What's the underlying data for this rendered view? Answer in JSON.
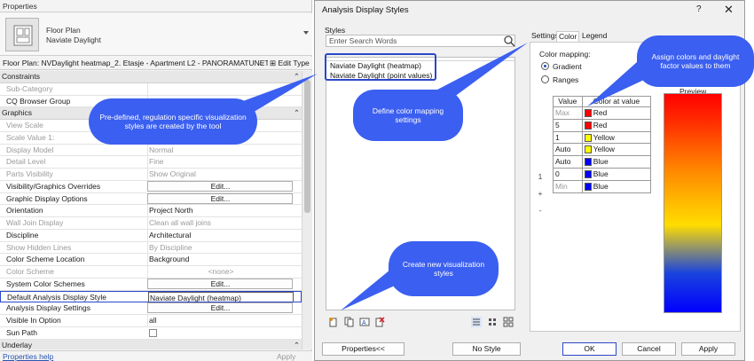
{
  "properties": {
    "title": "Properties",
    "type_line1": "Floor Plan",
    "type_line2": "Naviate Daylight",
    "instance_selector": "Floor Plan: NVDaylight heatmap_2. Etasje - Apartment L2 - PANORAMATUNET",
    "edit_type": "Edit Type",
    "rows": [
      {
        "kind": "cat",
        "label": "Constraints"
      },
      {
        "kind": "text",
        "label": "Sub-Category",
        "value": "",
        "grey": true
      },
      {
        "kind": "text",
        "label": "CQ Browser Group",
        "value": ""
      },
      {
        "kind": "cat",
        "label": "Graphics"
      },
      {
        "kind": "text",
        "label": "View Scale",
        "value": "",
        "grey": true
      },
      {
        "kind": "text",
        "label": "Scale Value    1:",
        "value": "",
        "grey": true
      },
      {
        "kind": "text",
        "label": "Display Model",
        "value": "Normal",
        "grey": true
      },
      {
        "kind": "text",
        "label": "Detail Level",
        "value": "Fine",
        "grey": true
      },
      {
        "kind": "text",
        "label": "Parts Visibility",
        "value": "Show Original",
        "grey": true
      },
      {
        "kind": "btn",
        "label": "Visibility/Graphics Overrides",
        "value": "Edit..."
      },
      {
        "kind": "btn",
        "label": "Graphic Display Options",
        "value": "Edit..."
      },
      {
        "kind": "text",
        "label": "Orientation",
        "value": "Project North"
      },
      {
        "kind": "text",
        "label": "Wall Join Display",
        "value": "Clean all wall joins",
        "grey": true
      },
      {
        "kind": "text",
        "label": "Discipline",
        "value": "Architectural"
      },
      {
        "kind": "text",
        "label": "Show Hidden Lines",
        "value": "By Discipline",
        "grey": true
      },
      {
        "kind": "text",
        "label": "Color Scheme Location",
        "value": "Background"
      },
      {
        "kind": "center",
        "label": "Color Scheme",
        "value": "<none>",
        "grey": true
      },
      {
        "kind": "btn",
        "label": "System Color Schemes",
        "value": "Edit..."
      },
      {
        "kind": "hl",
        "label": "Default Analysis Display Style",
        "value": "Naviate Daylight (heatmap)"
      },
      {
        "kind": "btn",
        "label": "Analysis Display Settings",
        "value": "Edit..."
      },
      {
        "kind": "text",
        "label": "Visible In Option",
        "value": "all"
      },
      {
        "kind": "check",
        "label": "Sun Path",
        "value": ""
      },
      {
        "kind": "cat",
        "label": "Underlay"
      }
    ],
    "help_link": "Properties help",
    "apply": "Apply"
  },
  "dialog": {
    "title": "Analysis Display Styles",
    "help": "?",
    "close": "✕",
    "styles_label": "Styles",
    "search_placeholder": "Enter Search Words",
    "styles": [
      "Naviate Daylight (heatmap)",
      "Naviate Daylight (point values)"
    ],
    "tabs": [
      "Settings",
      "Color",
      "Legend"
    ],
    "active_tab": "Color",
    "color_mapping_label": "Color mapping:",
    "gradient_label": "Gradient",
    "ranges_label": "Ranges",
    "table_headers": [
      "Value",
      "Color at value"
    ],
    "table_rows": [
      {
        "value": "Max",
        "color_name": "Red",
        "color": "#ff0000",
        "grey": true
      },
      {
        "value": "5",
        "color_name": "Red",
        "color": "#ff0000"
      },
      {
        "value": "1",
        "color_name": "Yellow",
        "color": "#ffff00"
      },
      {
        "value": "Auto",
        "color_name": "Yellow",
        "color": "#ffff00"
      },
      {
        "value": "Auto",
        "color_name": "Blue",
        "color": "#0000ff"
      },
      {
        "value": "0",
        "color_name": "Blue",
        "color": "#0000ff"
      },
      {
        "value": "Min",
        "color_name": "Blue",
        "color": "#0000ff",
        "grey": true
      }
    ],
    "row_tools": [
      "1",
      "+",
      "-"
    ],
    "preview_label": "Preview",
    "buttons": {
      "properties": "Properties<<",
      "no_style": "No Style",
      "ok": "OK",
      "cancel": "Cancel",
      "apply": "Apply"
    }
  },
  "callouts": {
    "predefined": "Pre-defined, regulation specific visualization styles are created by the tool",
    "define": "Define color mapping settings",
    "assign": "Assign colors and daylight factor values to them",
    "create": "Create new visualization styles"
  },
  "colors": {
    "accent": "#3b5ff0",
    "highlight": "#2b47c9"
  }
}
